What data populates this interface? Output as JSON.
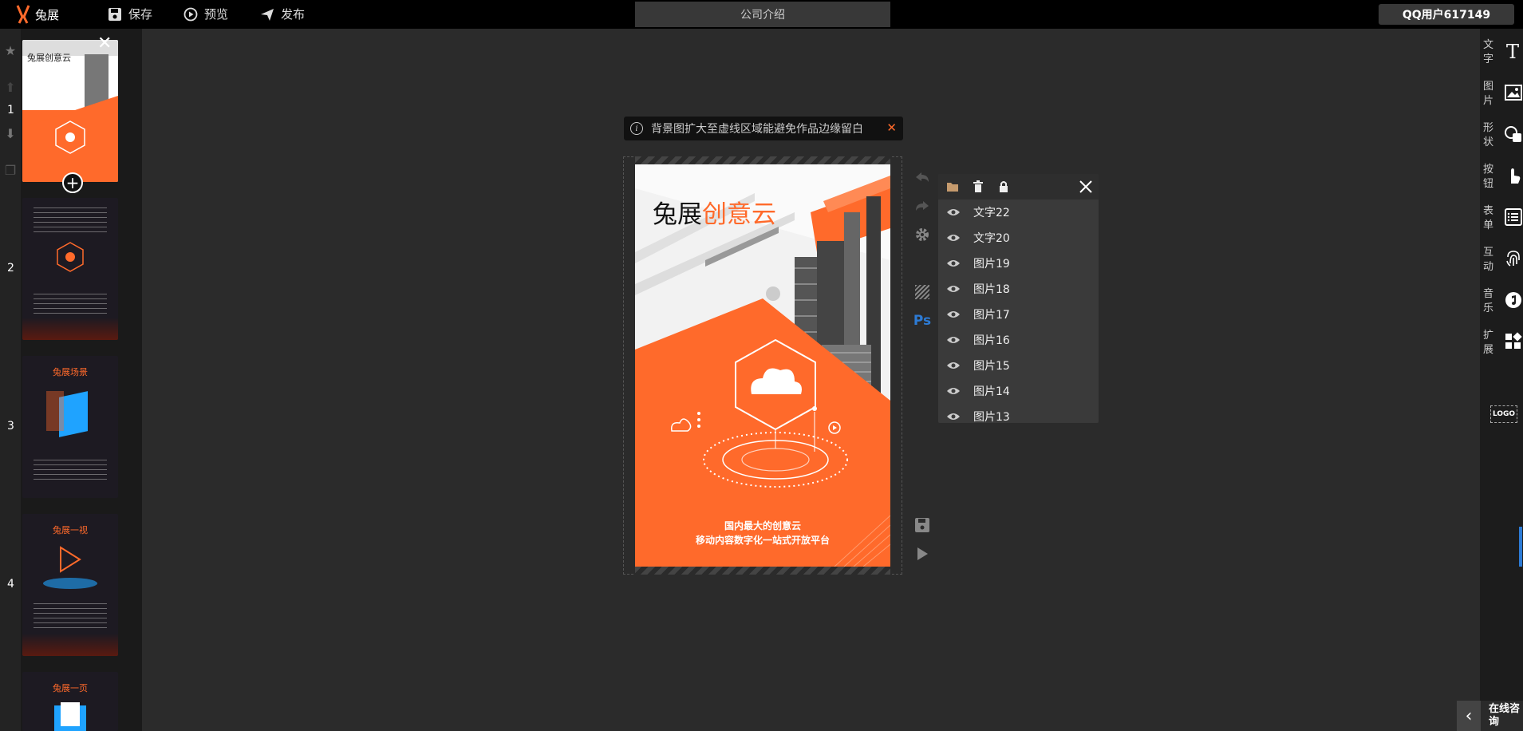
{
  "topbar": {
    "brand": "兔展",
    "save_label": "保存",
    "preview_label": "预览",
    "publish_label": "发布",
    "page_title": "公司介绍",
    "user": "QQ用户617149"
  },
  "pages": [
    {
      "num": "1",
      "title": "兔展创意云"
    },
    {
      "num": "2",
      "title": ""
    },
    {
      "num": "3",
      "title": "兔展场景"
    },
    {
      "num": "4",
      "title": "兔展一视"
    },
    {
      "num": "",
      "title": "兔展一页"
    }
  ],
  "notice": {
    "text": "背景图扩大至虚线区域能避免作品边缘留白"
  },
  "stage": {
    "heading_black": "兔展",
    "heading_orange": "创意云",
    "tagline1": "国内最大的创意云",
    "tagline2": "移动内容数字化一站式开放平台"
  },
  "layers": {
    "items": [
      "文字22",
      "文字20",
      "图片19",
      "图片18",
      "图片17",
      "图片16",
      "图片15",
      "图片14",
      "图片13"
    ]
  },
  "right_toolbar": {
    "items": [
      {
        "label": "文字",
        "icon": "text-icon"
      },
      {
        "label": "图片",
        "icon": "image-icon"
      },
      {
        "label": "形状",
        "icon": "shape-icon"
      },
      {
        "label": "按钮",
        "icon": "button-icon"
      },
      {
        "label": "表单",
        "icon": "form-icon"
      },
      {
        "label": "互动",
        "icon": "fingerprint-icon"
      },
      {
        "label": "音乐",
        "icon": "music-icon"
      },
      {
        "label": "扩展",
        "icon": "extend-icon"
      }
    ],
    "logo_label": "LOGO"
  },
  "consult": {
    "label": "在线咨询"
  },
  "colors": {
    "accent": "#ff6a2b",
    "topbar": "#000000",
    "panel": "#3a3a3a"
  }
}
